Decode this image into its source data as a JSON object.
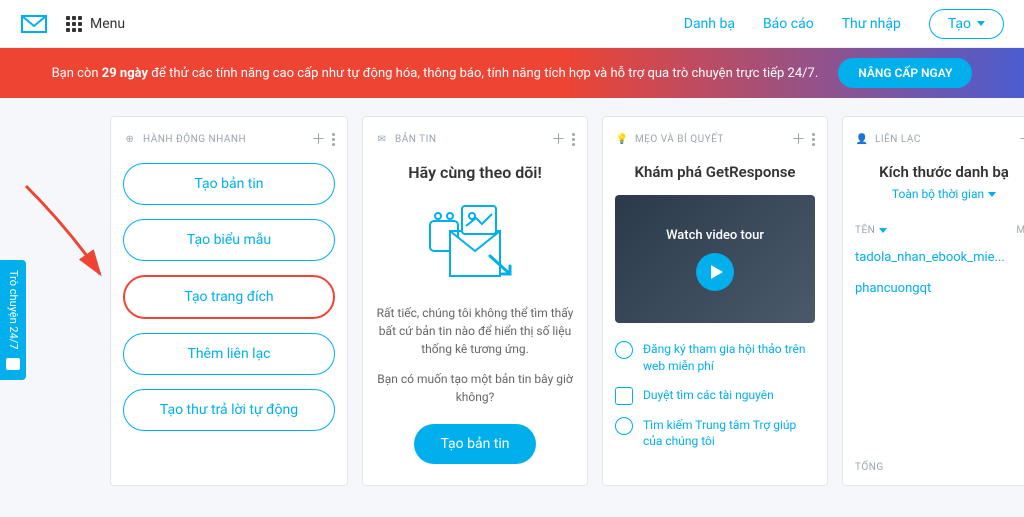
{
  "header": {
    "menu": "Menu",
    "nav": [
      "Danh bạ",
      "Báo cáo",
      "Thư nhập"
    ],
    "create": "Tạo"
  },
  "banner": {
    "prefix": "Bạn còn ",
    "days": "29 ngày",
    "suffix": " để thử các tính năng cao cấp như tự động hóa, thông báo, tính năng tích hợp và hỗ trợ qua trò chuyện trực tiếp 24/7.",
    "cta": "NÂNG CẤP NGAY"
  },
  "quickActions": {
    "title": "HÀNH ĐỘNG NHANH",
    "buttons": [
      "Tạo bản tin",
      "Tạo biểu mẫu",
      "Tạo trang đích",
      "Thêm liên lạc",
      "Tạo thư trả lời tự động"
    ]
  },
  "newsletter": {
    "title": "BẢN TIN",
    "heading": "Hãy cùng theo dõi!",
    "text1": "Rất tiếc, chúng tôi không thể tìm thấy bất cứ bản tin nào để hiển thị số liệu thống kê tương ứng.",
    "text2": "Bạn có muốn tạo một bản tin bây giờ không?",
    "cta": "Tạo bản tin"
  },
  "tips": {
    "title": "MẸO VÀ BÍ QUYẾT",
    "heading": "Khám phá GetResponse",
    "videoLabel": "Watch video tour",
    "links": [
      "Đăng ký tham gia hội thảo trên web miễn phí",
      "Duyệt tìm các tài nguyên",
      "Tìm kiếm Trung tâm Trợ giúp của chúng tôi"
    ]
  },
  "contacts": {
    "title": "LIÊN LẠC",
    "heading": "Kích thước danh bạ",
    "timeLabel": "Toàn bộ thời gian",
    "colName": "TÊN",
    "colSize": "MÔ",
    "rows": [
      "tadola_nhan_ebook_mie...",
      "phancuongqt"
    ],
    "total": "TỔNG"
  },
  "chat": "Trò chuyện 24/7"
}
